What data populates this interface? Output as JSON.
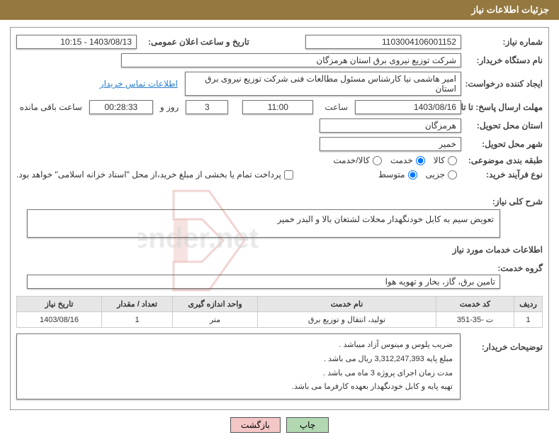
{
  "header": {
    "title": "جزئیات اطلاعات نیاز"
  },
  "fields": {
    "need_number_label": "شماره نیاز:",
    "need_number": "1103004106001152",
    "announce_label": "تاریخ و ساعت اعلان عمومی:",
    "announce": "1403/08/13 - 10:15",
    "buyer_org_label": "نام دستگاه خریدار:",
    "buyer_org": "شرکت توزیع نیروی برق استان هرمزگان",
    "requester_label": "ایجاد کننده درخواست:",
    "requester": "امیر هاشمی نیا کارشناس مسئول مطالعات فنی شرکت توزیع نیروی برق استان",
    "contact_link": "اطلاعات تماس خریدار",
    "deadline_label": "مهلت ارسال پاسخ: تا تاریخ:",
    "deadline_date": "1403/08/16",
    "time_label": "ساعت",
    "deadline_time": "11:00",
    "days_count": "3",
    "days_and": "روز و",
    "countdown": "00:28:33",
    "remaining": "ساعت باقی مانده",
    "province_label": "استان محل تحویل:",
    "province": "هرمزگان",
    "city_label": "شهر محل تحویل:",
    "city": "خمیر",
    "category_label": "طبقه بندی موضوعی:",
    "radio_goods": "کالا",
    "radio_service": "خدمت",
    "radio_both": "کالا/خدمت",
    "process_label": "نوع فرآیند خرید:",
    "radio_minor": "جزیی",
    "radio_medium": "متوسط",
    "payment_note": "پرداخت تمام یا بخشی از مبلغ خرید،از محل \"اسناد خزانه اسلامی\" خواهد بود.",
    "summary_label": "شرح کلی نیاز:",
    "summary": "تعویض سیم به کابل خودنگهدار محلات لشتغان بالا و البدر خمیر",
    "services_section": "اطلاعات خدمات مورد نیاز",
    "service_group_label": "گروه خدمت:",
    "service_group": "تامین برق، گاز، بخار و تهویه هوا",
    "buyer_desc_label": "توضیحات خریدار:"
  },
  "table": {
    "headers": {
      "row": "ردیف",
      "code": "کد خدمت",
      "name": "نام خدمت",
      "unit": "واحد اندازه گیری",
      "qty": "تعداد / مقدار",
      "need_date": "تاریخ نیاز"
    },
    "rows": [
      {
        "row": "1",
        "code": "ت -35-351",
        "name": "تولید، انتقال و توزیع برق",
        "unit": "متر",
        "qty": "1",
        "need_date": "1403/08/16"
      }
    ]
  },
  "buyer_notes": [
    "ضریب پلوس و مینوس آزاد میباشد .",
    "مبلغ پایه 3,312,247,393 ریال می باشد .",
    "مدت زمان اجرای پروژه 3 ماه می باشد .",
    "تهیه پایه و کابل خودنگهدار بعهده کارفرما می باشد."
  ],
  "buttons": {
    "print": "چاپ",
    "back": "بازگشت"
  },
  "watermark_text": "AriaTender.net"
}
